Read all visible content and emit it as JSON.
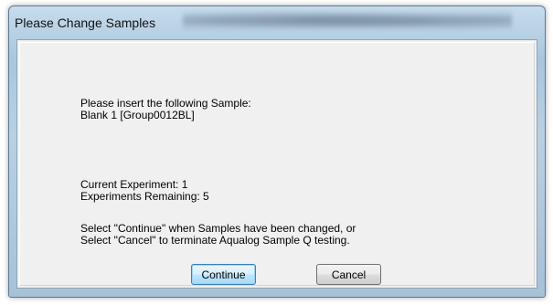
{
  "dialog": {
    "title": "Please Change Samples",
    "prompt_line1": "Please insert the following Sample:",
    "prompt_line2": "Blank 1 [Group0012BL]",
    "current_experiment": "Current Experiment: 1",
    "experiments_remaining": "Experiments Remaining: 5",
    "instruction_line1": "Select \"Continue\" when Samples have been changed, or",
    "instruction_line2": "Select \"Cancel\" to terminate Aqualog Sample Q testing.",
    "continue_label": "Continue",
    "cancel_label": "Cancel"
  }
}
